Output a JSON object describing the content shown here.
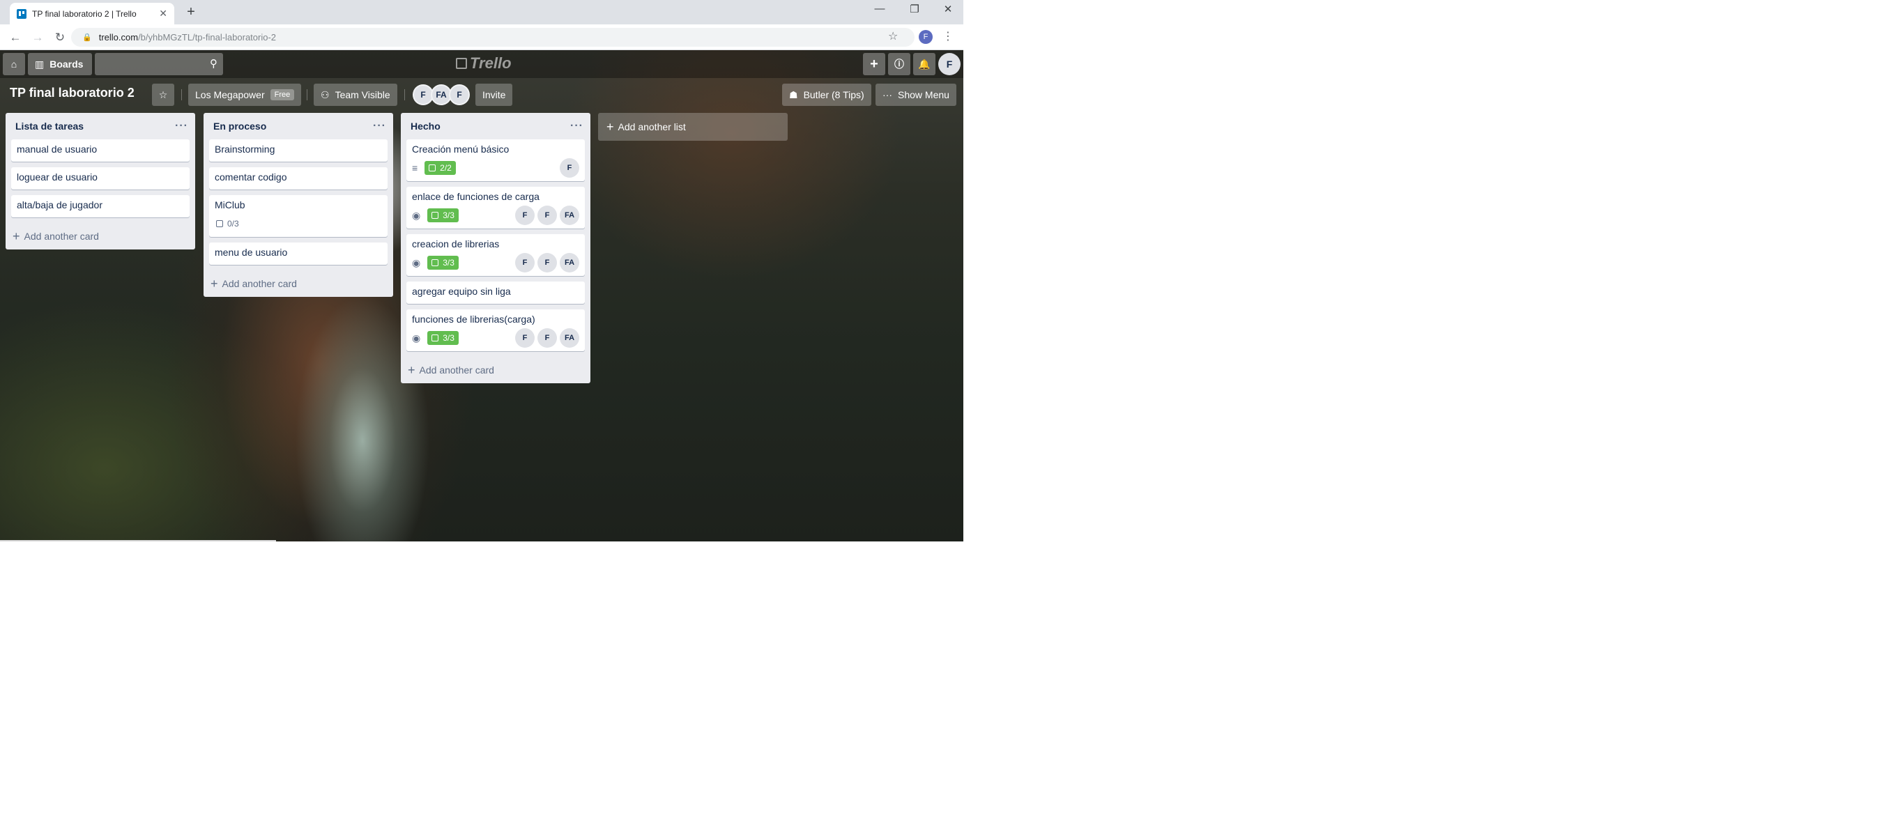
{
  "browser": {
    "tab_title": "TP final laboratorio 2 | Trello",
    "tab_close": "✕",
    "new_tab": "+",
    "url_host": "trello.com",
    "url_path": "/b/yhbMGzTL/tp-final-laboratorio-2",
    "profile_initial": "F",
    "window_controls": {
      "minimize": "—",
      "restore": "❐",
      "close": "✕"
    }
  },
  "header": {
    "boards_label": "Boards",
    "logo_text": "Trello",
    "user_initial": "F"
  },
  "board": {
    "title": "TP final laboratorio 2",
    "team_name": "Los Megapower",
    "team_plan": "Free",
    "visibility": "Team Visible",
    "members": [
      "F",
      "FA",
      "F"
    ],
    "invite_label": "Invite",
    "butler_label": "Butler (8 Tips)",
    "show_menu_label": "Show Menu"
  },
  "lists": [
    {
      "title": "Lista de tareas",
      "menu": "···",
      "cards": [
        {
          "title": "manual de usuario"
        },
        {
          "title": "loguear de usuario"
        },
        {
          "title": "alta/baja de jugador"
        }
      ],
      "add_card": "Add another card"
    },
    {
      "title": "En proceso",
      "menu": "···",
      "cards": [
        {
          "title": "Brainstorming"
        },
        {
          "title": "comentar codigo"
        },
        {
          "title": "MiClub",
          "checklist": "0/3"
        },
        {
          "title": "menu de usuario"
        }
      ],
      "add_card": "Add another card"
    },
    {
      "title": "Hecho",
      "menu": "···",
      "cards": [
        {
          "title": "Creación menú básico",
          "checklist": "2/2",
          "members": [
            "F"
          ]
        },
        {
          "title": "enlace de funciones de carga",
          "checklist": "3/3",
          "members": [
            "F",
            "F",
            "FA"
          ]
        },
        {
          "title": "creacion de librerias",
          "checklist": "3/3",
          "members": [
            "F",
            "F",
            "FA"
          ]
        },
        {
          "title": "agregar equipo sin liga"
        },
        {
          "title": "funciones de librerias(carga)",
          "checklist": "3/3",
          "members": [
            "F",
            "F",
            "FA"
          ]
        }
      ],
      "add_card": "Add another card"
    }
  ],
  "add_list_label": "Add another list",
  "colors": {
    "checklist_complete": "#61bd4f",
    "list_bg": "#ebecf0",
    "text": "#172b4d"
  }
}
